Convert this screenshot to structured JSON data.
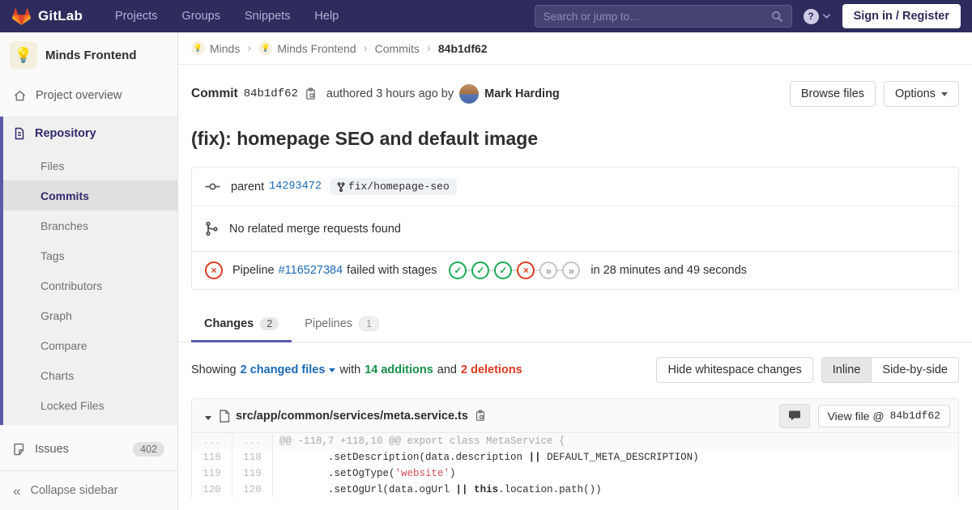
{
  "navbar": {
    "logo": "GitLab",
    "links": [
      "Projects",
      "Groups",
      "Snippets",
      "Help"
    ],
    "search_placeholder": "Search or jump to…",
    "help": "?",
    "signin": "Sign in / Register"
  },
  "sidebar": {
    "project": {
      "name": "Minds Frontend",
      "avatar": "💡"
    },
    "overview": "Project overview",
    "repository": "Repository",
    "repo_items": [
      "Files",
      "Commits",
      "Branches",
      "Tags",
      "Contributors",
      "Graph",
      "Compare",
      "Charts",
      "Locked Files"
    ],
    "active_repo_item": "Commits",
    "issues": {
      "label": "Issues",
      "count": "402"
    },
    "collapse": "Collapse sidebar",
    "collapse_icon": "«"
  },
  "breadcrumb": {
    "items": [
      {
        "label": "Minds",
        "avatar": "💡"
      },
      {
        "label": "Minds Frontend",
        "avatar": "💡"
      },
      {
        "label": "Commits"
      },
      {
        "label": "84b1df62"
      }
    ],
    "separator": "›"
  },
  "commit": {
    "label": "Commit",
    "sha": "84b1df62",
    "authored": "authored 3 hours ago by",
    "author": "Mark Harding",
    "browse_files": "Browse files",
    "options": "Options",
    "title": "(fix): homepage SEO and default image",
    "parent_label": "parent",
    "parent_sha": "14293472",
    "branch": "fix/homepage-seo",
    "mr_text": "No related merge requests found",
    "pipeline": {
      "label": "Pipeline",
      "id": "#116527384",
      "status_text": "failed with stages",
      "stages": [
        "success",
        "success",
        "success",
        "failed",
        "skipped",
        "skipped"
      ],
      "success_glyph": "✓",
      "failed_glyph": "×",
      "skipped_glyph": "»",
      "duration": "in 28 minutes and 49 seconds"
    }
  },
  "tabs": [
    {
      "label": "Changes",
      "count": "2",
      "active": true
    },
    {
      "label": "Pipelines",
      "count": "1",
      "active": false
    }
  ],
  "summary": {
    "showing": "Showing",
    "changed_files": "2 changed files",
    "with": "with",
    "additions": "14 additions",
    "and": "and",
    "deletions": "2 deletions",
    "hide_whitespace": "Hide whitespace changes",
    "inline": "Inline",
    "side_by_side": "Side-by-side"
  },
  "diff": {
    "file_path": "src/app/common/services/meta.service.ts",
    "view_file": "View file @",
    "view_file_sha": "84b1df62",
    "hunk": {
      "old": "...",
      "new": "...",
      "text": "@@ -118,7 +118,10 @@ export class MetaService {"
    },
    "lines": [
      {
        "old": "118",
        "new": "118",
        "s1": "        .setDescription(data.description ",
        "op": "||",
        "s2": " DEFAULT_META_DESCRIPTION)"
      },
      {
        "old": "119",
        "new": "119",
        "s1": "        .setOgType(",
        "str": "'website'",
        "s2": ")"
      },
      {
        "old": "120",
        "new": "120",
        "s1": "        .setOgUrl(data.ogUrl ",
        "op": "||",
        "s2": " ",
        "kw": "this",
        "s3": ".location.path())"
      }
    ]
  }
}
